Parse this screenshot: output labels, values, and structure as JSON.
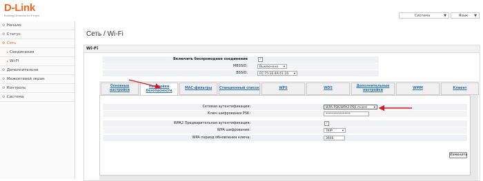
{
  "header": {
    "logo_text": "D-Link",
    "logo_tagline": "Building Networks for People",
    "system_select": "Система",
    "language_select": "Язык"
  },
  "sidebar": {
    "items": [
      {
        "label": "Начало"
      },
      {
        "label": "Статус"
      },
      {
        "label": "Сеть"
      },
      {
        "label": "Соединения"
      },
      {
        "label": "Wi-Fi"
      },
      {
        "label": "Дополнительно"
      },
      {
        "label": "Межсетевой экран"
      },
      {
        "label": "Контроль"
      },
      {
        "label": "Система"
      }
    ]
  },
  "main": {
    "title": "Сеть /  Wi-Fi",
    "panel_title": "Wi-Fi",
    "enable_label": "Включить беспроводное соединение",
    "enable_checked": true,
    "mbssid_label": "MBSSID:",
    "mbssid_value": "Выключено",
    "bssid_label": "BSSID:",
    "bssid_value": "FC:75:16:4A:41:16",
    "tabs": [
      {
        "label": "Основные настройки"
      },
      {
        "label": "Настройки безопасности"
      },
      {
        "label": "MAC-фильтры"
      },
      {
        "label": "Станционный список"
      },
      {
        "label": "WPS"
      },
      {
        "label": "WDS"
      },
      {
        "label": "Дополнительные настройки"
      },
      {
        "label": "WMM"
      },
      {
        "label": "Клиент"
      }
    ],
    "active_tab": 1,
    "security": {
      "auth_label": "Сетевая аутентификация:",
      "auth_value": "WPA-PSK/WPA2-PSK mixed",
      "psk_label": "Ключ шифрования PSK:",
      "psk_value": "****************",
      "preauth_label": "WPA2 Предварительная аутентификация:",
      "preauth_checked": true,
      "enc_label": "WPA шифрование:",
      "enc_value": "TKIP",
      "period_label": "WPA период обновления ключа:",
      "period_value": "3600",
      "change_button": "Изменить"
    }
  },
  "colors": {
    "brand": "#f26522",
    "tab_text": "#2a6fb3",
    "annotation_arrow": "#e0141e"
  }
}
